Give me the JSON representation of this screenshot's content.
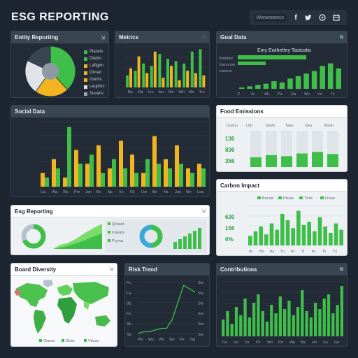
{
  "app": {
    "title": "ESG REPORTING"
  },
  "social": {
    "chip": "Wwwooeecs",
    "icons": [
      "f",
      "t",
      "d",
      "s"
    ]
  },
  "colors": {
    "green": "#3fbf4a",
    "green_light": "#7bdc6b",
    "yellow": "#f2b521",
    "dark_green": "#2f8f3a"
  },
  "panels": {
    "entity_reporting": {
      "title": "Entity Reporting",
      "tool": "⇲",
      "legend": [
        "Plansis",
        "Dlelrio",
        "Laftgen",
        "Glvser",
        "Gonlrs",
        "Leuphrc",
        "Suvans"
      ]
    },
    "metrics": {
      "title": "Metrics",
      "tool": "□",
      "ticks": [
        "Ba",
        "Da",
        "Lm",
        "Ian",
        "Mn",
        "Wn",
        "Mn",
        "Trn"
      ]
    },
    "goal_data": {
      "title": "Goal Data",
      "tool": "⧉",
      "subtitle": "Emy Ewthethry Tautcatio",
      "labels": [
        "Mrdddd",
        "Eanonoo",
        "Iamess"
      ],
      "ticks": [
        "2",
        "Ar",
        "Ah",
        "Pa",
        "Ga",
        "Ws",
        "Vn",
        "Ts"
      ]
    },
    "social_stats": {
      "title": "Social Data",
      "tool": "",
      "ticks": [
        "Ua",
        "Wa",
        "Wo",
        "Pm",
        "Jan",
        "Bn",
        "Sp",
        "Vu",
        "Fb",
        "Uw",
        "Bn",
        "Ya",
        "Jan",
        "Wn",
        "Lws"
      ]
    },
    "food_emissions": {
      "title": "Food Emissions",
      "tool": "",
      "headers": [
        "Dusnu",
        "Lhit",
        "Ilosih",
        "Taes",
        "Deu",
        "Mssh"
      ],
      "values": [
        "136",
        "836",
        "356"
      ]
    },
    "esg_reporting": {
      "title": "Esg Reporting",
      "tool": "⇲",
      "legend": [
        "Qlinant",
        "Ioseats",
        "Pryma"
      ]
    },
    "carbon_impact": {
      "title": "Carbon Impact",
      "tool": "",
      "legend": [
        "Bncinc",
        "Pleuw",
        "Tmls",
        "Lhaar"
      ],
      "values": [
        "630",
        "156",
        "6%"
      ],
      "ticks": [
        "Ar",
        "Ns",
        "As",
        "Tu",
        "Ar",
        "Ti",
        "Ar",
        "Ts",
        "Tu"
      ]
    },
    "board_diversity": {
      "title": "Board Diversity",
      "tool": "⇲",
      "legend": [
        "Giarsa",
        "Dluts",
        "Vdcsa"
      ]
    },
    "risk_trend": {
      "title": "Risk Trend",
      "tool": "",
      "yleft": [
        "Fs",
        "Fa",
        "Bb",
        "Fs",
        "Sb",
        "Sb"
      ],
      "yright": [
        "Ste",
        "Ste",
        "Ste",
        "Ste",
        "Ste",
        "Ste"
      ],
      "ticks": [
        "Wn",
        "Ws",
        "Ws",
        "Ws",
        "Pe",
        "Na"
      ]
    },
    "contributions": {
      "title": "Contributions",
      "tool": "⧉",
      "ticks": [
        "Gn",
        "Gn",
        "Vs",
        "Ps",
        "Wn",
        "Pn",
        "Wa",
        "Ba",
        "Hn",
        "Sa",
        "Gn"
      ]
    }
  },
  "chart_data": [
    {
      "id": "metrics",
      "type": "bar",
      "series": [
        {
          "name": "green",
          "values": [
            5,
            7,
            10,
            9,
            14,
            12,
            11,
            10,
            15,
            16
          ]
        },
        {
          "name": "yellow",
          "values": [
            8,
            13,
            6,
            15,
            4,
            9,
            3,
            7,
            6,
            5
          ]
        }
      ]
    },
    {
      "id": "goal_data",
      "type": "bar",
      "values": [
        1,
        2,
        3,
        4,
        6,
        5,
        8,
        10,
        12,
        14,
        18,
        20,
        16
      ]
    },
    {
      "id": "social_stats",
      "type": "bar",
      "series": [
        {
          "name": "yellow",
          "values": [
            3,
            6,
            2,
            8,
            5,
            9,
            4,
            10,
            7,
            3,
            11,
            6,
            9,
            4,
            5
          ]
        },
        {
          "name": "green",
          "values": [
            2,
            4,
            13,
            5,
            7,
            3,
            6,
            4,
            3,
            6,
            5,
            4,
            5,
            3,
            4
          ]
        }
      ]
    },
    {
      "id": "food_emissions",
      "type": "bar",
      "values": [
        18,
        22,
        20,
        25,
        28,
        24
      ]
    },
    {
      "id": "carbon_impact",
      "type": "bar",
      "values": [
        6,
        9,
        12,
        7,
        14,
        10,
        20,
        16,
        11,
        22,
        13,
        15,
        9,
        18,
        12,
        8,
        14,
        10
      ]
    },
    {
      "id": "contributions",
      "type": "bar",
      "values": [
        8,
        12,
        6,
        14,
        10,
        18,
        9,
        16,
        20,
        12,
        7,
        15,
        11,
        19,
        13,
        17,
        10,
        14,
        22,
        12,
        9,
        16,
        13,
        18,
        20,
        11,
        15,
        24
      ]
    },
    {
      "id": "risk_trend",
      "type": "line",
      "values": [
        0,
        1,
        1,
        2,
        3,
        3,
        8,
        18,
        28,
        26,
        24
      ]
    },
    {
      "id": "entity_reporting",
      "type": "pie",
      "values": [
        38,
        22,
        22,
        18
      ]
    }
  ]
}
